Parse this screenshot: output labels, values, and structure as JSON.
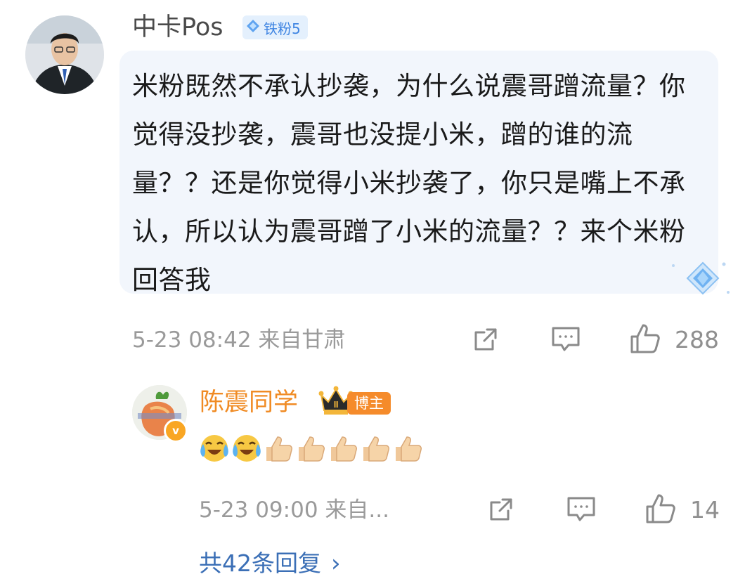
{
  "comment": {
    "username": "中卡Pos",
    "fan_badge": "铁粉5",
    "text": "米粉既然不承认抄袭，为什么说震哥蹭流量？你觉得没抄袭，震哥也没提小米，蹭的谁的流量？？还是你觉得小米抄袭了，你只是嘴上不承认，所以认为震哥蹭了小米的流量？？来个米粉回答我",
    "timestamp": "5-23 08:42 来自甘肃",
    "like_count": "288",
    "icons": [
      "share-icon",
      "comment-icon",
      "like-icon"
    ]
  },
  "reply": {
    "username": "陈震同学",
    "host_badge": "博主",
    "crown_level": "Ⅲ",
    "verified_icon": "v",
    "emojis": [
      "laugh-cry",
      "laugh-cry",
      "thumbs-up",
      "thumbs-up",
      "thumbs-up",
      "thumbs-up",
      "thumbs-up"
    ],
    "timestamp": "5-23 09:00 来自...",
    "like_count": "14"
  },
  "more_replies": {
    "label": "共42条回复",
    "arrow": "›"
  },
  "colors": {
    "bubble_bg": "#f2f6fc",
    "blogger_name": "#f08b24",
    "link_blue": "#3b6fb6",
    "meta_gray": "#9a9a9a"
  }
}
